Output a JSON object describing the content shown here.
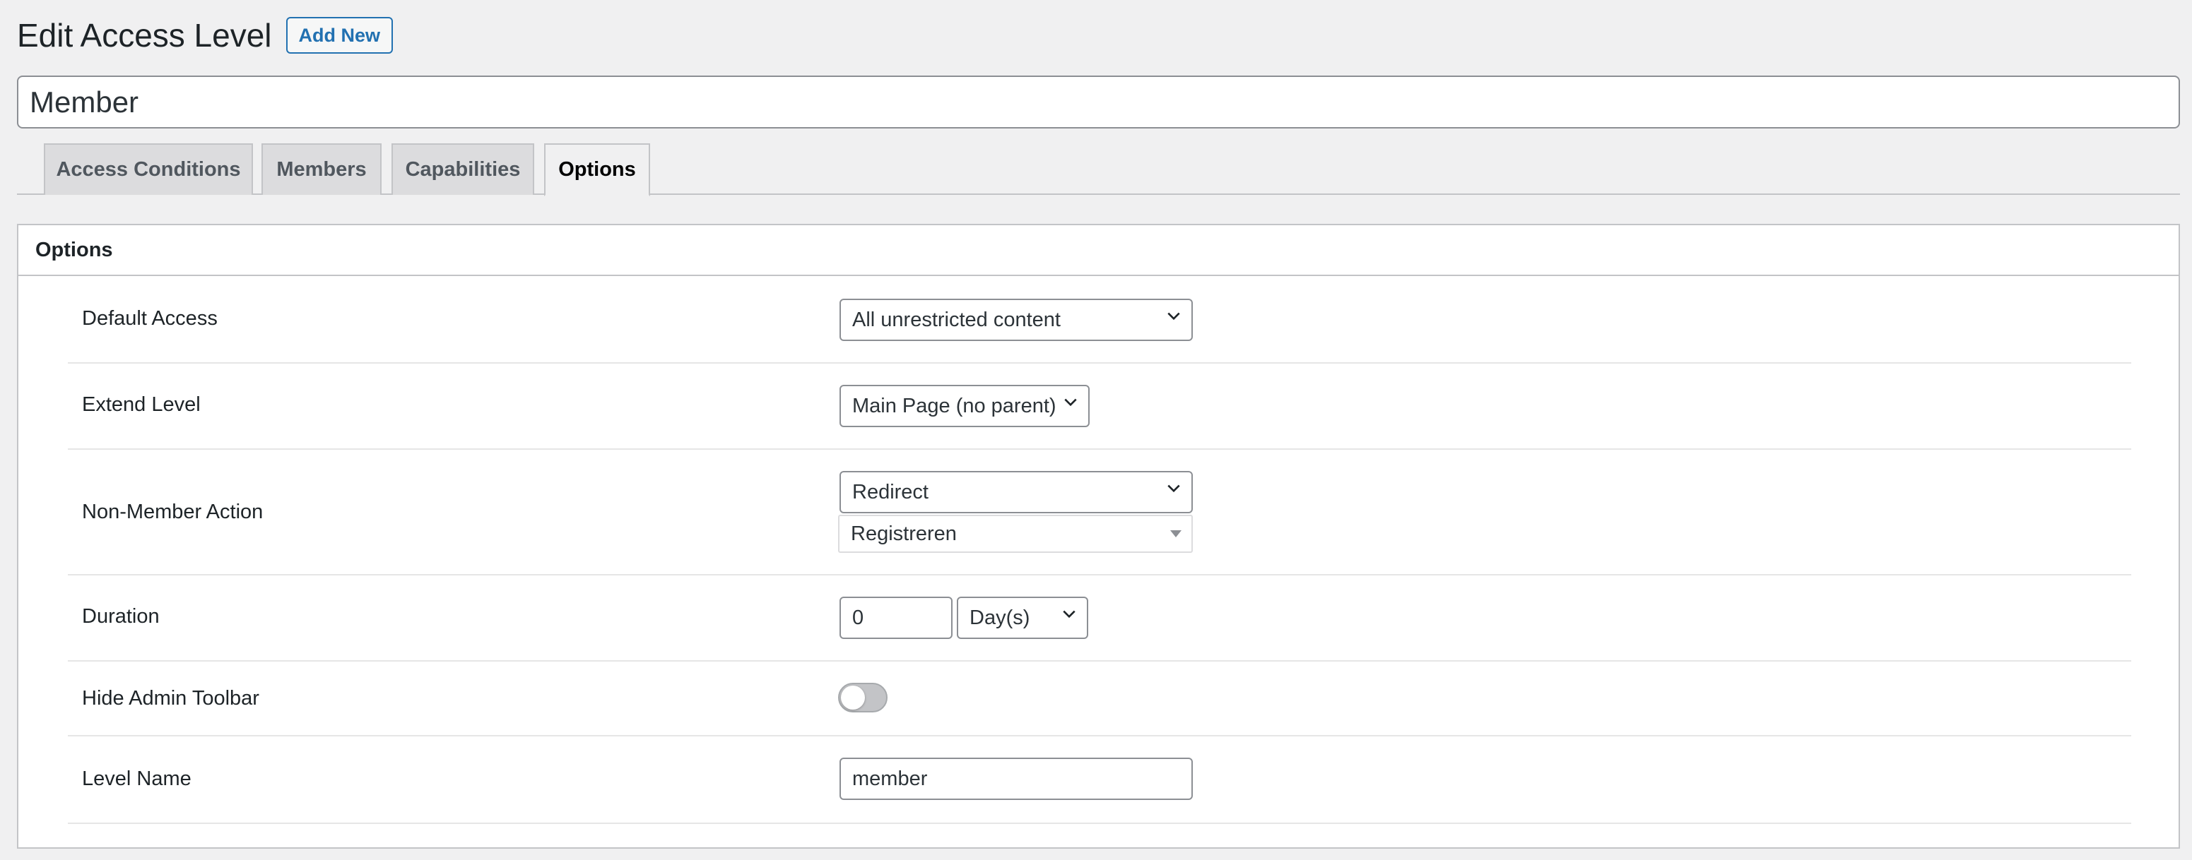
{
  "header": {
    "title": "Edit Access Level",
    "add_new_label": "Add New"
  },
  "level_title": {
    "value": "Member"
  },
  "tabs": [
    {
      "label": "Access Conditions",
      "active": false
    },
    {
      "label": "Members",
      "active": false
    },
    {
      "label": "Capabilities",
      "active": false
    },
    {
      "label": "Options",
      "active": true
    }
  ],
  "options_panel": {
    "heading": "Options",
    "default_access": {
      "label": "Default Access",
      "selected": "All unrestricted content"
    },
    "extend_level": {
      "label": "Extend Level",
      "selected": "Main Page (no parent)"
    },
    "non_member_action": {
      "label": "Non-Member Action",
      "selected": "Redirect",
      "redirect_target": "Registreren"
    },
    "duration": {
      "label": "Duration",
      "value": "0",
      "unit": "Day(s)"
    },
    "hide_admin_toolbar": {
      "label": "Hide Admin Toolbar",
      "enabled": false
    },
    "level_name": {
      "label": "Level Name",
      "value": "member"
    }
  },
  "colors": {
    "accent": "#2271b1",
    "background": "#f0f0f1",
    "border": "#c3c4c7"
  }
}
